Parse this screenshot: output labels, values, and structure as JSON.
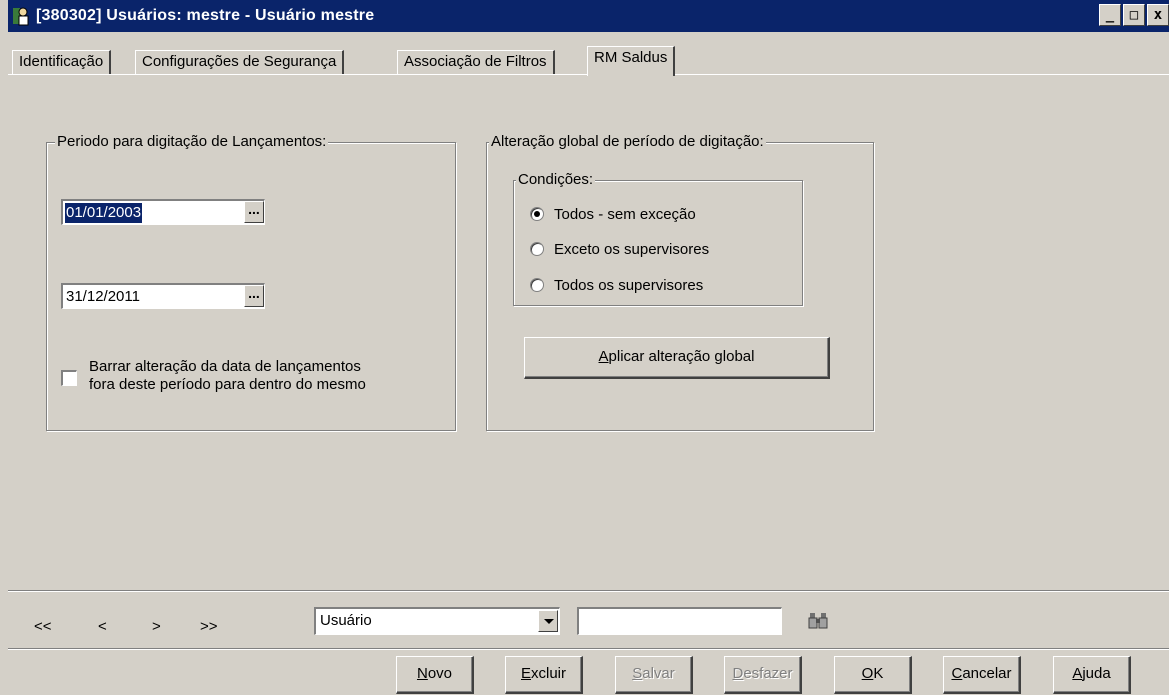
{
  "window": {
    "title": "[380302] Usuários: mestre - Usuário mestre",
    "buttons": {
      "minimize": "_",
      "maximize": "□",
      "close": "x"
    }
  },
  "tabs": [
    {
      "label": "Identificação",
      "active": false
    },
    {
      "label": "Configurações de Segurança",
      "active": false
    },
    {
      "label": "Associação de Filtros",
      "active": false
    },
    {
      "label": "RM Saldus",
      "active": true
    }
  ],
  "period_group": {
    "legend": "Periodo para digitação de Lançamentos:",
    "start_date": "01/01/2003",
    "end_date": "31/12/2011",
    "picker_glyph": "...",
    "block_checkbox": {
      "checked": false,
      "label_line1": "Barrar alteração da data de lançamentos",
      "label_line2": "fora deste período para dentro do mesmo"
    }
  },
  "global_group": {
    "legend": "Alteração global de período de digitação:",
    "conditions": {
      "legend": "Condições:",
      "options": [
        {
          "label": "Todos - sem exceção",
          "selected": true
        },
        {
          "label": "Exceto os supervisores",
          "selected": false
        },
        {
          "label": "Todos os supervisores",
          "selected": false
        }
      ]
    },
    "apply_button": "Aplicar alteração global"
  },
  "navigation": {
    "first": "<<",
    "prev": "<",
    "next": ">",
    "last": ">>",
    "field_select": "Usuário",
    "search_value": ""
  },
  "actions": [
    {
      "label": "Novo",
      "enabled": true
    },
    {
      "label": "Excluir",
      "enabled": true
    },
    {
      "label": "Salvar",
      "enabled": false
    },
    {
      "label": "Desfazer",
      "enabled": false
    },
    {
      "label": "OK",
      "enabled": true
    },
    {
      "label": "Cancelar",
      "enabled": true
    },
    {
      "label": "Ajuda",
      "enabled": true
    }
  ]
}
